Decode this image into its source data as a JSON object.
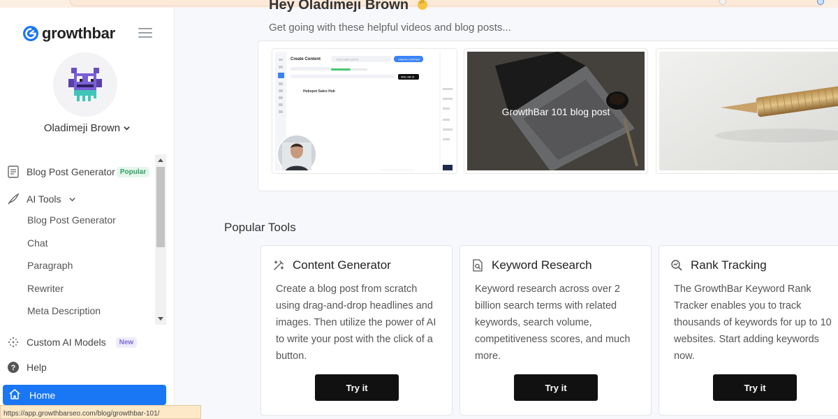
{
  "sidebar": {
    "logo_text": "growthbar",
    "user_name": "Oladimeji Brown",
    "nav": {
      "blog_post_generator": "Blog Post Generator",
      "popular_badge": "Popular",
      "ai_tools": "AI Tools",
      "sub_items": [
        "Blog Post Generator",
        "Chat",
        "Paragraph",
        "Rewriter",
        "Meta Description"
      ],
      "custom_models": "Custom AI Models",
      "new_badge": "New",
      "help": "Help",
      "home": "Home"
    },
    "status_url": "https://app.growthbarseo.com/blog/growthbar-101/"
  },
  "main": {
    "greeting": "Hey Oladimeji Brown",
    "subtext": "Get going with these helpful videos and blog posts...",
    "video_cards": {
      "screenshot": {
        "title": "Create Content",
        "search_placeholder": "Find a writer (ctrl+k)",
        "button": "CREATE CONTENT",
        "heading": "Hubspot Sales Hub",
        "chip": "Write with AI"
      },
      "blog_label": "GrowthBar 101 blog post"
    },
    "popular_tools_title": "Popular Tools",
    "tools": [
      {
        "title": "Content Generator",
        "desc": "Create a blog post from scratch using drag-and-drop headlines and images. Then utilize the power of AI to write your post with the click of a button.",
        "button": "Try it"
      },
      {
        "title": "Keyword Research",
        "desc": "Keyword research across over 2 billion search terms with related keywords, search volume, competitiveness scores, and much more.",
        "button": "Try it"
      },
      {
        "title": "Rank Tracking",
        "desc": "The GrowthBar Keyword Rank Tracker enables you to track thousands of keywords for up to 10 websites. Start adding keywords now.",
        "button": "Try it"
      }
    ]
  },
  "colors": {
    "accent": "#1976f5",
    "button_dark": "#111111",
    "badge_green": "#2f9e63",
    "badge_purple": "#7c6cdb"
  }
}
